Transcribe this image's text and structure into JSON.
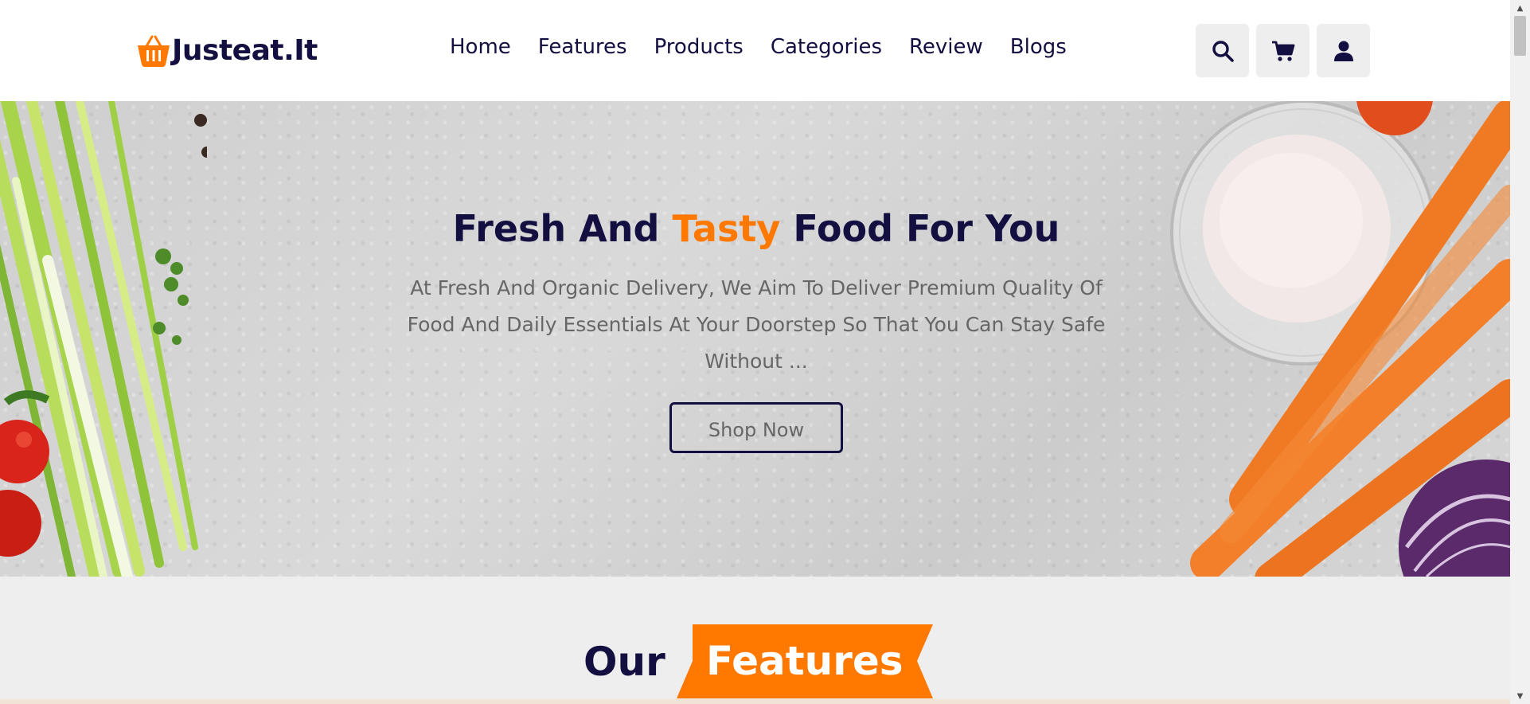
{
  "header": {
    "logo_text": "Justeat.It",
    "nav": [
      {
        "label": "Home"
      },
      {
        "label": "Features"
      },
      {
        "label": "Products"
      },
      {
        "label": "Categories"
      },
      {
        "label": "Review"
      },
      {
        "label": "Blogs"
      }
    ],
    "icons": [
      "search-icon",
      "cart-icon",
      "user-icon"
    ]
  },
  "hero": {
    "title_part1": "Fresh And ",
    "title_accent": "Tasty",
    "title_part2": " Food For You",
    "description": "At Fresh And Organic Delivery, We Aim To Deliver Premium Quality Of Food And Daily Essentials At Your Doorstep So That You Can Stay Safe Without ...",
    "button_label": "Shop Now"
  },
  "features": {
    "heading_plain": "Our",
    "heading_badge": "Features"
  },
  "colors": {
    "brand_dark": "#130f40",
    "accent": "#ff7800",
    "text_gray": "#666666"
  }
}
